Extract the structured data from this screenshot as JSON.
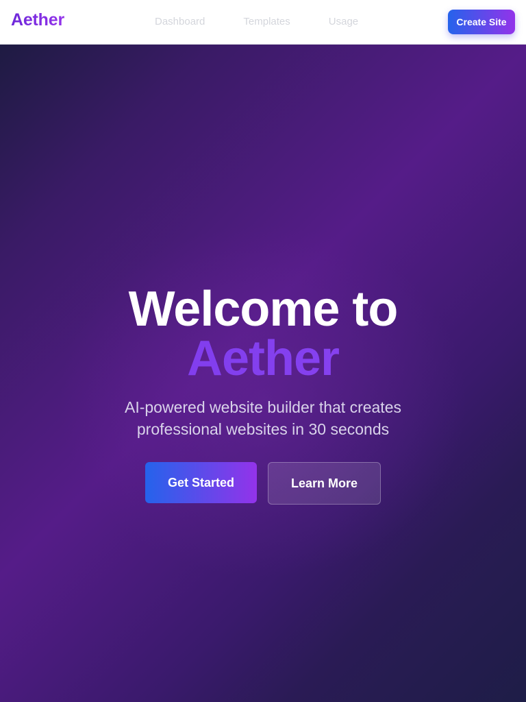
{
  "header": {
    "logo": "Aether",
    "nav": [
      {
        "label": "Dashboard"
      },
      {
        "label": "Templates"
      },
      {
        "label": "Usage"
      }
    ],
    "cta_label": "Create Site"
  },
  "hero": {
    "title_line1": "Welcome to",
    "title_line2": "Aether",
    "subtitle": "AI-powered website builder that creates professional websites in 30 seconds",
    "primary_button": "Get Started",
    "secondary_button": "Learn More"
  },
  "colors": {
    "brand_purple": "#7c3aed",
    "gradient_start": "#2563eb",
    "gradient_end": "#9333ea",
    "hero_bg_dark": "#1e1b42",
    "hero_bg_mid": "#551c88",
    "nav_link_gray": "#d4d6dc"
  }
}
